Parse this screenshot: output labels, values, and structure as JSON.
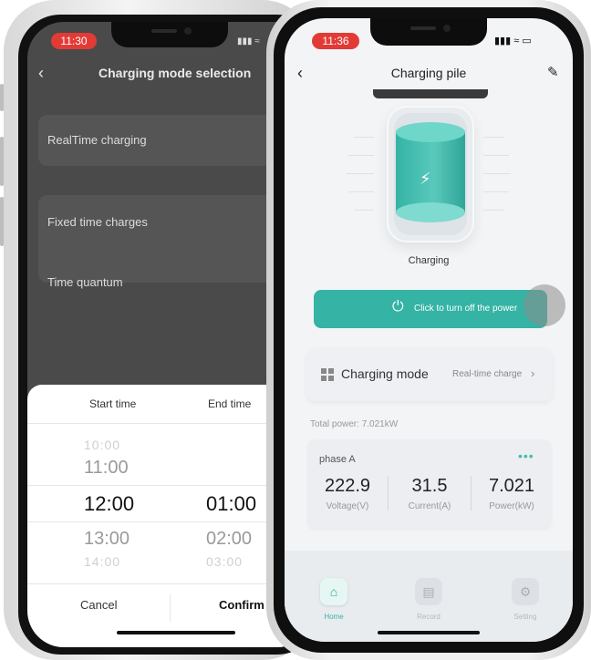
{
  "back_phone": {
    "status_time": "11:30",
    "title": "Charging mode selection",
    "options": {
      "realtime": "RealTime charging",
      "fixed": "Fixed time charges",
      "quantum": "Time quantum"
    },
    "picker": {
      "start_header": "Start time",
      "end_header": "End time",
      "start_values": [
        "10:00",
        "11:00",
        "12:00",
        "13:00",
        "14:00"
      ],
      "end_values": [
        "01:00",
        "02:00",
        "03:00"
      ],
      "cancel": "Cancel",
      "confirm": "Confirm"
    }
  },
  "front_phone": {
    "status_time": "11:36",
    "title": "Charging pile",
    "status": "Charging",
    "power_button": "Click to turn off the power",
    "mode": {
      "label": "Charging mode",
      "value": "Real-time charge"
    },
    "total_power": "Total power: 7.021kW",
    "phase": {
      "name": "phase A",
      "voltage_value": "222.9",
      "voltage_label": "Voltage(V)",
      "current_value": "31.5",
      "current_label": "Current(A)",
      "power_value": "7.021",
      "power_label": "Power(kW)"
    },
    "tabs": {
      "home": "Home",
      "record": "Record",
      "setting": "Setting"
    }
  },
  "colors": {
    "accent": "#35b3a5",
    "status_red": "#e23b36"
  }
}
